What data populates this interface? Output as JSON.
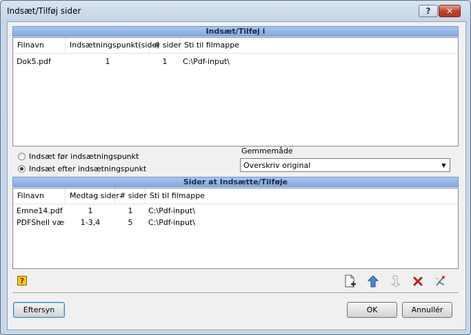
{
  "window": {
    "title": "Indsæt/Tilføj sider",
    "help_glyph": "?",
    "close_glyph": "✕"
  },
  "insert_group": {
    "header": "Indsæt/Tilføj i",
    "columns": [
      "Filnavn",
      "Indsætningspunkt(side)",
      "# sider",
      "Sti til filmappe"
    ],
    "rows": [
      {
        "filename": "Dok5.pdf",
        "insert_point": "1",
        "pages": "1",
        "path": "C:\\Pdf-input\\"
      }
    ]
  },
  "options": {
    "radio_before": "Indsæt før indsætningspunkt",
    "radio_after": "Indsæt efter indsætningspunkt",
    "selected": "after",
    "save_mode_label": "Gemmemåde",
    "save_mode_value": "Overskriv original"
  },
  "pages_group": {
    "header": "Sider at Indsætte/Tilføje",
    "columns": [
      "Filnavn",
      "Medtag sider",
      "# sider",
      "Sti til filmappe"
    ],
    "rows": [
      {
        "filename": "Emne14.pdf",
        "include": "1",
        "pages": "1",
        "path": "C:\\Pdf-input\\"
      },
      {
        "filename": "PDFShell vær",
        "include": "1-3,4",
        "pages": "5",
        "path": "C:\\Pdf-input\\"
      }
    ]
  },
  "toolbar": {
    "icons": [
      "add-page-icon",
      "move-up-icon",
      "move-down-icon",
      "delete-icon",
      "edit-icon"
    ],
    "help_glyph": "?"
  },
  "buttons": {
    "preview": "Eftersyn",
    "ok": "OK",
    "cancel": "Annullér"
  }
}
